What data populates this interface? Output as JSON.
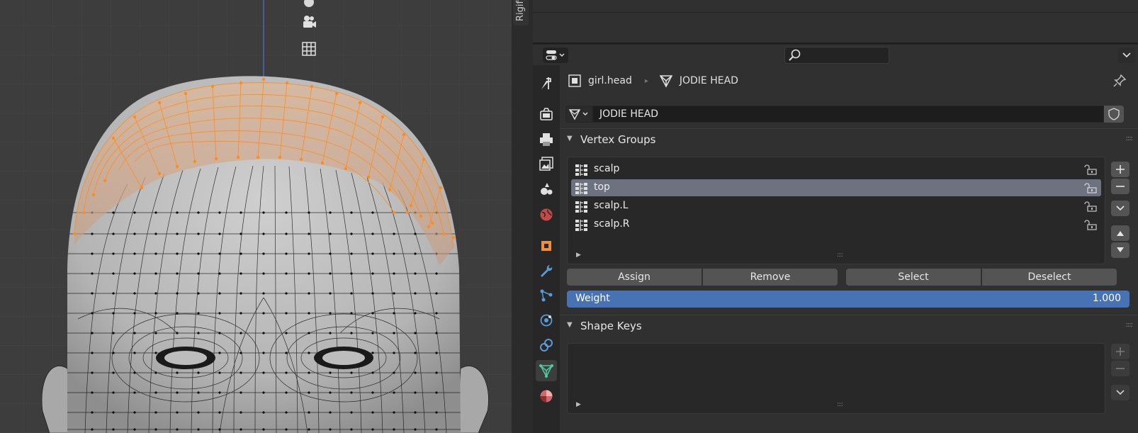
{
  "sidebar_tab": {
    "label": "Rigify"
  },
  "search": {
    "placeholder": ""
  },
  "breadcrumb": {
    "object": "girl.head",
    "data": "JODIE HEAD"
  },
  "mesh": {
    "name": "JODIE HEAD"
  },
  "vertex_groups": {
    "title": "Vertex Groups",
    "items": [
      {
        "name": "scalp",
        "selected": false
      },
      {
        "name": "top",
        "selected": true
      },
      {
        "name": "scalp.L",
        "selected": false
      },
      {
        "name": "scalp.R",
        "selected": false
      }
    ],
    "buttons": {
      "assign": "Assign",
      "remove": "Remove",
      "select": "Select",
      "deselect": "Deselect"
    },
    "weight": {
      "label": "Weight",
      "value": "1.000"
    }
  },
  "shape_keys": {
    "title": "Shape Keys"
  },
  "colors": {
    "accent": "#4772b3",
    "selected_row": "#6d7280",
    "mesh_orange": "#ff8c1a",
    "data_tab_green": "#4ec9a0"
  },
  "icons": [
    "tool-icon",
    "render-icon",
    "output-icon",
    "view-layer-icon",
    "scene-icon",
    "world-icon",
    "object-icon",
    "modifier-icon",
    "particles-icon",
    "physics-icon",
    "constraints-icon",
    "mesh-data-icon",
    "material-icon"
  ]
}
